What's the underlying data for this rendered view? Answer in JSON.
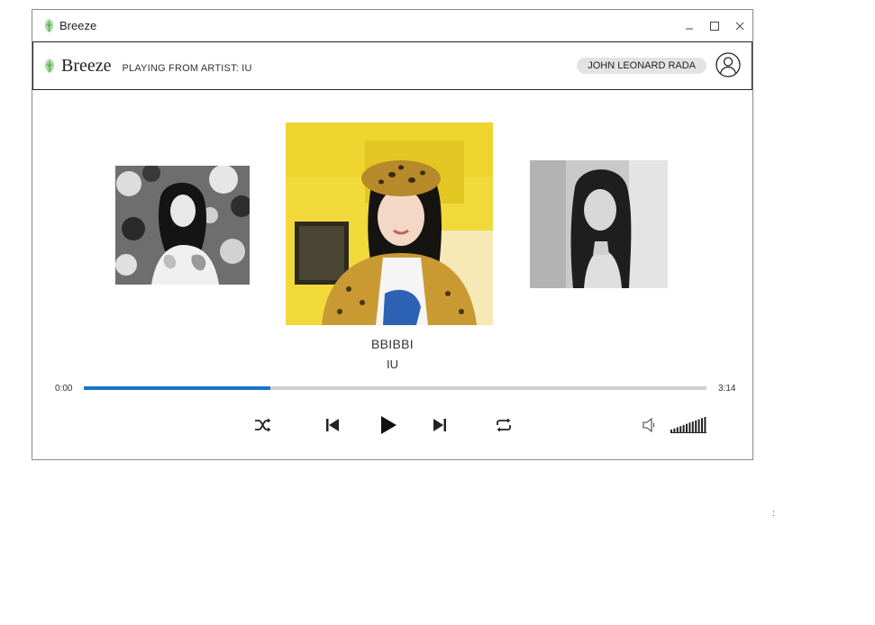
{
  "window": {
    "title": "Breeze",
    "controls": [
      "minimize-icon",
      "maximize-icon",
      "close-icon"
    ]
  },
  "header": {
    "logo_text": "Breeze",
    "playing_from": "PLAYING FROM ARTIST: IU",
    "user_name": "JOHN LEONARD RADA",
    "avatar_icon": "user-avatar-icon"
  },
  "now_playing": {
    "title": "BBIBBI",
    "artist": "IU",
    "time_elapsed": "0:00",
    "time_total": "3:14",
    "progress": 0.3
  },
  "controls": {
    "icons": [
      "shuffle-icon",
      "previous-icon",
      "play-icon",
      "next-icon",
      "repeat-icon",
      "volume-icon"
    ],
    "volume_level": 1.0
  },
  "colors": {
    "accent": "#1a73c9",
    "track": "#cfcfcf",
    "pill": "#e3e3e3"
  },
  "stray_text": ":"
}
